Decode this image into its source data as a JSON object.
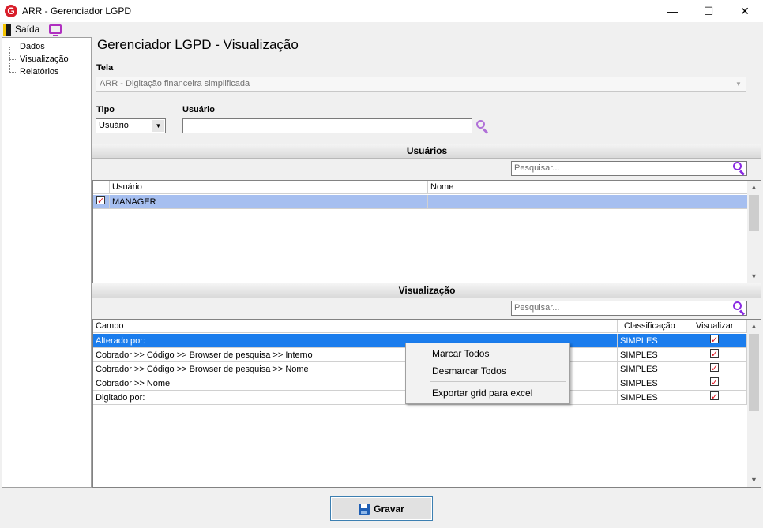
{
  "window": {
    "title": "ARR - Gerenciador LGPD",
    "minimize": "—",
    "maximize": "☐",
    "close": "✕"
  },
  "toolbar": {
    "exit_label": "Saída"
  },
  "tree": {
    "items": [
      "Dados",
      "Visualização",
      "Relatórios"
    ]
  },
  "main": {
    "title": "Gerenciador LGPD - Visualização"
  },
  "tela": {
    "label": "Tela",
    "value": "ARR - Digitação financeira simplificada"
  },
  "tipo": {
    "label": "Tipo",
    "value": "Usuário"
  },
  "usuario_filter": {
    "label": "Usuário",
    "value": ""
  },
  "usuarios_section": {
    "title": "Usuários",
    "search_placeholder": "Pesquisar...",
    "columns": [
      "Usuário",
      "Nome"
    ],
    "rows": [
      {
        "usuario": "MANAGER",
        "nome": "",
        "checked": true
      }
    ]
  },
  "visualizacao_section": {
    "title": "Visualização",
    "search_placeholder": "Pesquisar...",
    "columns": [
      "Campo",
      "Classificação",
      "Visualizar"
    ],
    "rows": [
      {
        "campo": "Alterado por:",
        "classificacao": "SIMPLES",
        "visualizar": true
      },
      {
        "campo": "Cobrador >> Código >> Browser de pesquisa >> Interno",
        "classificacao": "SIMPLES",
        "visualizar": true
      },
      {
        "campo": "Cobrador >> Código >> Browser de pesquisa >> Nome",
        "classificacao": "SIMPLES",
        "visualizar": true
      },
      {
        "campo": "Cobrador >> Nome",
        "classificacao": "SIMPLES",
        "visualizar": true
      },
      {
        "campo": "Digitado por:",
        "classificacao": "SIMPLES",
        "visualizar": true
      }
    ]
  },
  "context_menu": {
    "items": [
      "Marcar Todos",
      "Desmarcar Todos",
      "Exportar grid para excel"
    ]
  },
  "save_button": {
    "label": "Gravar"
  },
  "colors": {
    "selected_row": "#a6bff0",
    "highlight_row": "#1b7ded",
    "accent_purple": "#8a2be2",
    "check_red": "#e0101b"
  },
  "icons": [
    "app-logo-icon",
    "exit-icon",
    "screen-icon",
    "search-icon",
    "chevron-down-icon",
    "save-disk-icon",
    "checkbox-icon"
  ]
}
